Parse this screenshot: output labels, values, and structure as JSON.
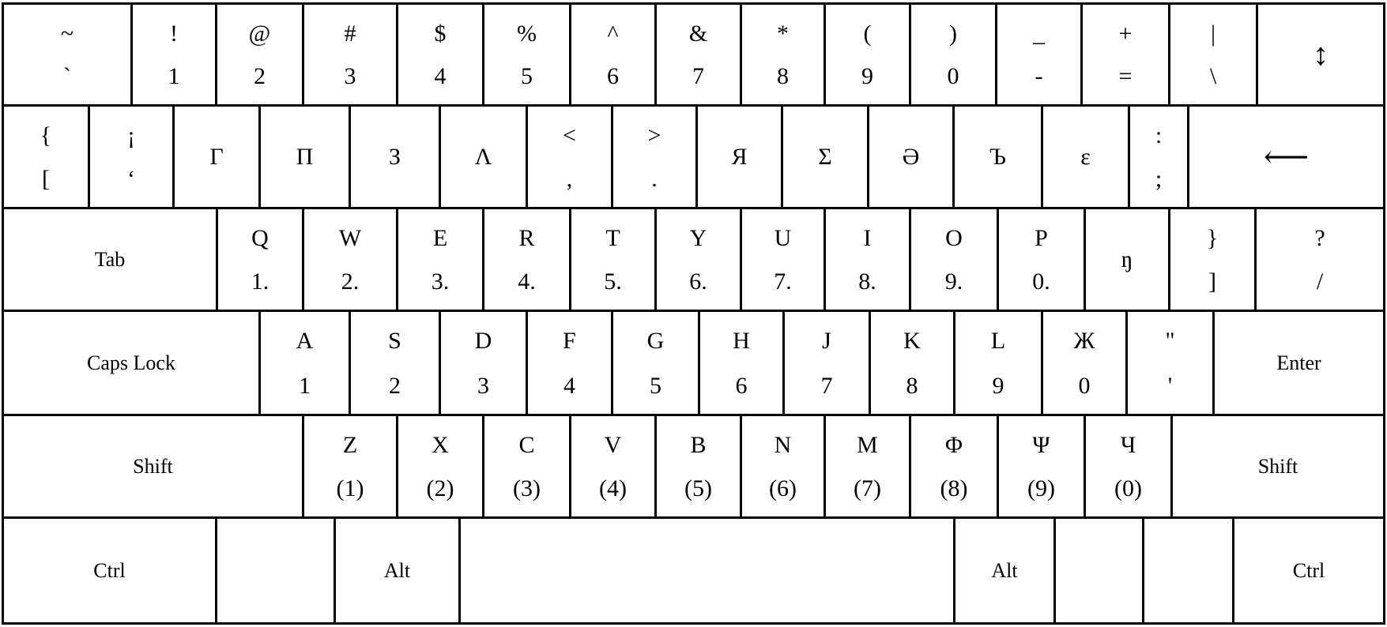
{
  "keyboard": {
    "rows": [
      {
        "name": "number-row",
        "keys": [
          {
            "id": "backtick",
            "top": "~",
            "bottom": "`"
          },
          {
            "id": "1",
            "top": "!",
            "bottom": "1"
          },
          {
            "id": "2",
            "top": "@",
            "bottom": "2"
          },
          {
            "id": "3",
            "top": "#",
            "bottom": "3"
          },
          {
            "id": "4",
            "top": "$",
            "bottom": "4"
          },
          {
            "id": "5",
            "top": "%",
            "bottom": "5"
          },
          {
            "id": "6",
            "top": "^",
            "bottom": "6"
          },
          {
            "id": "7",
            "top": "&",
            "bottom": "7"
          },
          {
            "id": "8",
            "top": "*",
            "bottom": "8"
          },
          {
            "id": "9",
            "top": "(",
            "bottom": "9"
          },
          {
            "id": "0",
            "top": ")",
            "bottom": "0"
          },
          {
            "id": "minus",
            "top": "_",
            "bottom": "-"
          },
          {
            "id": "equals",
            "top": "+",
            "bottom": "="
          },
          {
            "id": "backslash",
            "top": "|",
            "bottom": "\\"
          },
          {
            "id": "up-down",
            "center": "↕",
            "icon": "up-down-arrow-icon"
          }
        ]
      },
      {
        "name": "symbol-row",
        "keys": [
          {
            "id": "bracket-left",
            "top": "{",
            "bottom": "["
          },
          {
            "id": "glottal",
            "top": "¡",
            "bottom": "ʻ"
          },
          {
            "id": "gamma",
            "center": "Γ"
          },
          {
            "id": "pi",
            "center": "П"
          },
          {
            "id": "ze",
            "center": "З"
          },
          {
            "id": "lambda",
            "center": "Λ"
          },
          {
            "id": "comma",
            "top": "<",
            "bottom": ","
          },
          {
            "id": "period",
            "top": ">",
            "bottom": "."
          },
          {
            "id": "ya",
            "center": "Я"
          },
          {
            "id": "sigma",
            "center": "Σ"
          },
          {
            "id": "schwa",
            "center": "Ә"
          },
          {
            "id": "hard-sign",
            "center": "Ъ"
          },
          {
            "id": "epsilon",
            "center": "ε"
          },
          {
            "id": "semicolon",
            "top": ":",
            "bottom": ";"
          },
          {
            "id": "backspace",
            "center": "⟵",
            "icon": "left-arrow-icon"
          }
        ]
      },
      {
        "name": "qwerty-row",
        "keys": [
          {
            "id": "tab",
            "center": "Tab",
            "label": true
          },
          {
            "id": "q",
            "top": "Q",
            "bottom": "1."
          },
          {
            "id": "w",
            "top": "W",
            "bottom": "2."
          },
          {
            "id": "e",
            "top": "E",
            "bottom": "3."
          },
          {
            "id": "r",
            "top": "R",
            "bottom": "4."
          },
          {
            "id": "t",
            "top": "T",
            "bottom": "5."
          },
          {
            "id": "y",
            "top": "Y",
            "bottom": "6."
          },
          {
            "id": "u",
            "top": "U",
            "bottom": "7."
          },
          {
            "id": "i",
            "top": "I",
            "bottom": "8."
          },
          {
            "id": "o",
            "top": "O",
            "bottom": "9."
          },
          {
            "id": "p",
            "top": "P",
            "bottom": "0."
          },
          {
            "id": "eng",
            "center": "ŋ"
          },
          {
            "id": "bracket-right",
            "top": "}",
            "bottom": "]"
          },
          {
            "id": "slash",
            "top": "?",
            "bottom": "/"
          }
        ]
      },
      {
        "name": "home-row",
        "keys": [
          {
            "id": "caps-lock",
            "center": "Caps Lock",
            "label": true
          },
          {
            "id": "a",
            "top": "A",
            "bottom": "1"
          },
          {
            "id": "s",
            "top": "S",
            "bottom": "2"
          },
          {
            "id": "d",
            "top": "D",
            "bottom": "3"
          },
          {
            "id": "f",
            "top": "F",
            "bottom": "4"
          },
          {
            "id": "g",
            "top": "G",
            "bottom": "5"
          },
          {
            "id": "h",
            "top": "H",
            "bottom": "6"
          },
          {
            "id": "j",
            "top": "J",
            "bottom": "7"
          },
          {
            "id": "k",
            "top": "K",
            "bottom": "8"
          },
          {
            "id": "l",
            "top": "L",
            "bottom": "9"
          },
          {
            "id": "zhe",
            "top": "Ж",
            "bottom": "0"
          },
          {
            "id": "quote",
            "top": "\"",
            "bottom": "'"
          },
          {
            "id": "enter",
            "center": "Enter",
            "label": true
          }
        ]
      },
      {
        "name": "shift-row",
        "keys": [
          {
            "id": "shift-left",
            "center": "Shift",
            "label": true
          },
          {
            "id": "z",
            "top": "Z",
            "bottom": "(1)"
          },
          {
            "id": "x",
            "top": "X",
            "bottom": "(2)"
          },
          {
            "id": "c",
            "top": "C",
            "bottom": "(3)"
          },
          {
            "id": "v",
            "top": "V",
            "bottom": "(4)"
          },
          {
            "id": "b",
            "top": "B",
            "bottom": "(5)"
          },
          {
            "id": "n",
            "top": "N",
            "bottom": "(6)"
          },
          {
            "id": "m",
            "top": "M",
            "bottom": "(7)"
          },
          {
            "id": "phi",
            "top": "Φ",
            "bottom": "(8)"
          },
          {
            "id": "psi",
            "top": "Ψ",
            "bottom": "(9)"
          },
          {
            "id": "che",
            "top": "Ч",
            "bottom": "(0)"
          },
          {
            "id": "shift-right",
            "center": "Shift",
            "label": true
          }
        ]
      },
      {
        "name": "bottom-row",
        "keys": [
          {
            "id": "ctrl-left",
            "center": "Ctrl",
            "label": true
          },
          {
            "id": "blank-left",
            "center": ""
          },
          {
            "id": "alt-left",
            "center": "Alt",
            "label": true
          },
          {
            "id": "space",
            "center": ""
          },
          {
            "id": "alt-right",
            "center": "Alt",
            "label": true
          },
          {
            "id": "blank-right-1",
            "center": ""
          },
          {
            "id": "blank-right-2",
            "center": ""
          },
          {
            "id": "ctrl-right",
            "center": "Ctrl",
            "label": true
          }
        ]
      }
    ]
  }
}
